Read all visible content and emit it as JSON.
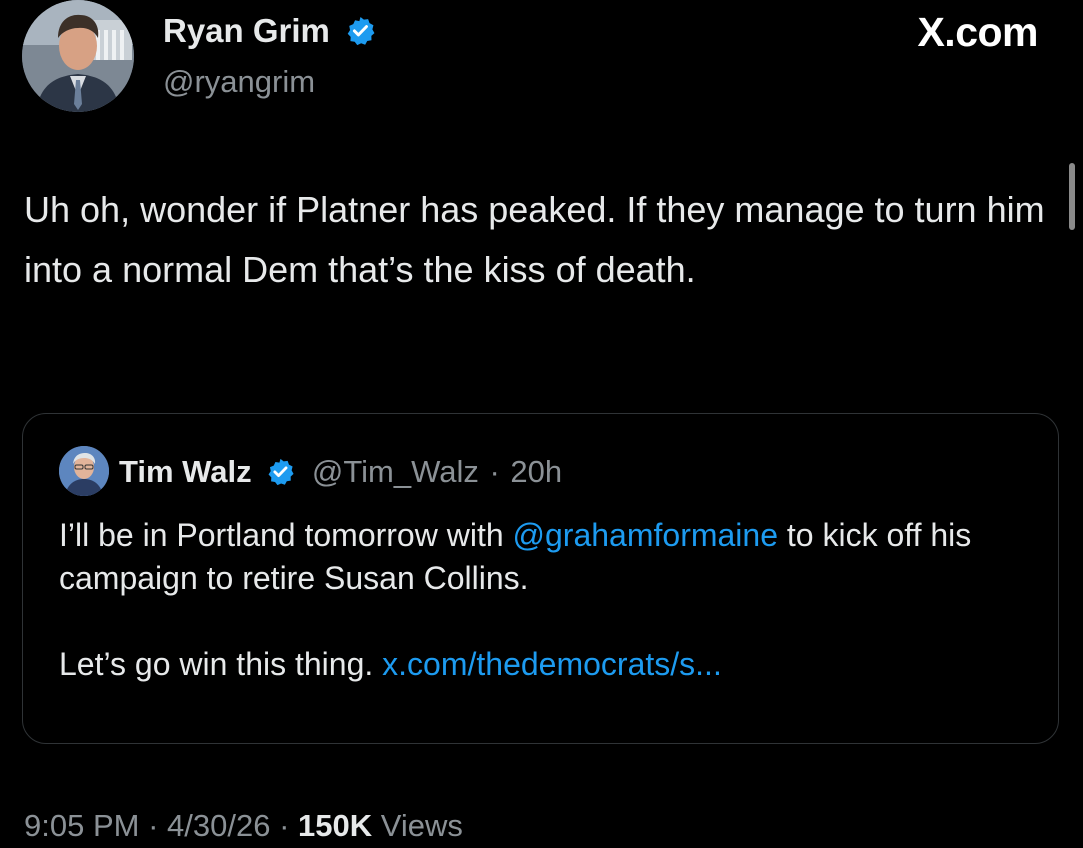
{
  "author": {
    "name": "Ryan Grim",
    "handle": "@ryangrim",
    "verified": true
  },
  "brand": {
    "text": "X.com"
  },
  "tweet": {
    "text": "Uh oh, wonder if Platner has peaked. If they manage to turn him into a normal Dem that’s the kiss of death."
  },
  "quoted_tweet": {
    "author_name": "Tim Walz",
    "handle": "@Tim_Walz",
    "separator": "·",
    "time": "20h",
    "verified": true,
    "body": {
      "line1_text_a": "I’ll be in Portland tomorrow with ",
      "mention": "@grahamformaine",
      "line1_text_b": " to kick off his campaign to retire Susan Collins.",
      "line2_text": "Let’s go win this thing. ",
      "link": "x.com/thedemocrats/s..."
    }
  },
  "footer": {
    "time": "9:05 PM",
    "date": "4/30/26",
    "separator": "·",
    "views_count": "150K",
    "views_label": "Views"
  },
  "colors": {
    "background": "#000000",
    "text": "#e7e9ea",
    "secondary_text": "#8b9196",
    "link": "#1d9bf0",
    "verified_badge": "#1d9bf0",
    "border": "#2f3336"
  }
}
